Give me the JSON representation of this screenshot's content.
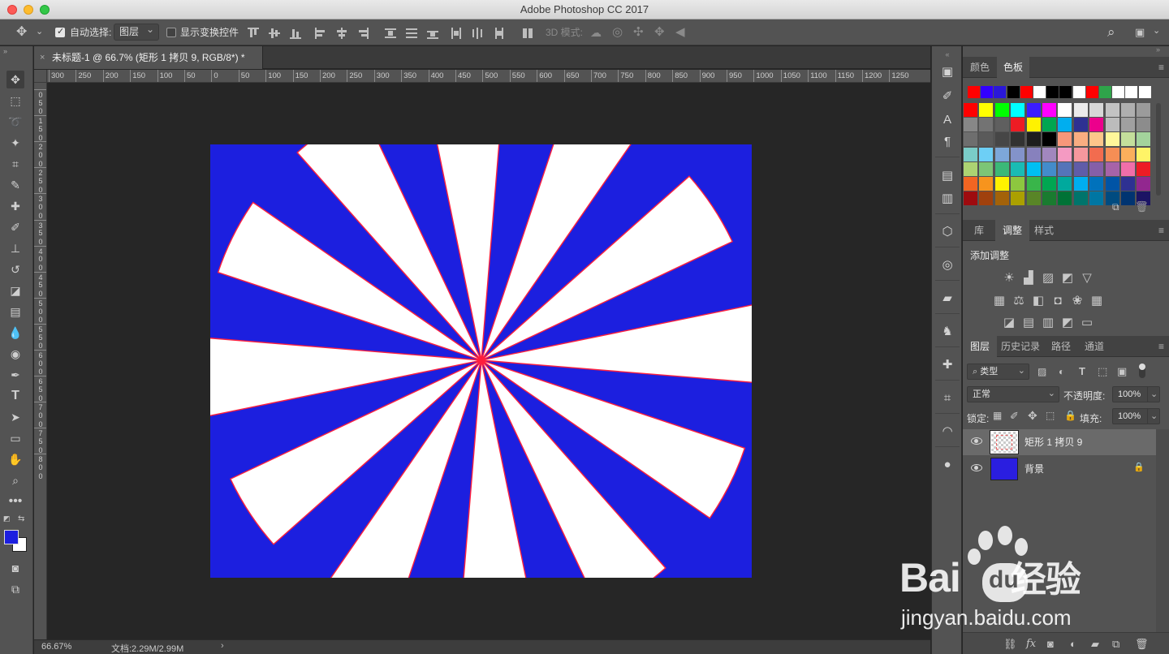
{
  "app": {
    "title": "Adobe Photoshop CC 2017"
  },
  "options_bar": {
    "auto_select_label": "自动选择:",
    "auto_select_target": "图层",
    "show_transform_label": "显示变换控件",
    "mode_3d_label": "3D 模式:"
  },
  "document": {
    "tab_title": "未标题-1 @ 66.7% (矩形 1 拷贝 9, RGB/8*) *",
    "close_glyph": "×"
  },
  "ruler": {
    "h_ticks": [
      "300",
      "250",
      "200",
      "150",
      "100",
      "50",
      "0",
      "50",
      "100",
      "150",
      "200",
      "250",
      "300",
      "350",
      "400",
      "450",
      "500",
      "550",
      "600",
      "650",
      "700",
      "750",
      "800",
      "850",
      "900",
      "950",
      "1000",
      "1050",
      "1100",
      "1150",
      "1200",
      "1250"
    ],
    "v_ticks": [
      "0",
      "5",
      "0",
      "1",
      "5",
      "0",
      "2",
      "0",
      "0",
      "2",
      "5",
      "0",
      "3",
      "0",
      "0",
      "3",
      "5",
      "0",
      "4",
      "0",
      "0",
      "4",
      "5",
      "0",
      "5",
      "0",
      "0",
      "5",
      "5",
      "0",
      "6",
      "0",
      "0",
      "6",
      "5",
      "0",
      "7",
      "0",
      "0",
      "7",
      "5",
      "0",
      "8",
      "0",
      "0"
    ]
  },
  "status": {
    "zoom": "66.67%",
    "doc": "文档:2.29M/2.99M"
  },
  "canvas": {
    "background_color": "#1c1fdf",
    "ray_fill": "#ffffff",
    "ray_stroke": "#ff1f3d",
    "rays_count": 12
  },
  "swatches_panel": {
    "tabs": [
      "颜色",
      "色板"
    ],
    "active_tab": "色板",
    "recent": [
      "#ff0000",
      "#3200ff",
      "#2a18d8",
      "#000000",
      "#ff0000",
      "#ffffff",
      "#000000",
      "#000000",
      "#ffffff",
      "#ff0000",
      "#2fa44a",
      "#ffffff",
      "#ffffff",
      "#ffffff"
    ],
    "grid": [
      [
        "#ff0000",
        "#ffff00",
        "#00ff00",
        "#00ffff",
        "#3b1cff",
        "#ff00ff",
        "#ffffff",
        "#ebebeb",
        "#d7d7d7",
        "#c3c3c3",
        "#afafaf",
        "#9b9b9b"
      ],
      [
        "#878787",
        "#737373",
        "#5f5f5f",
        "#ed1c24",
        "#fff200",
        "#00a651",
        "#00aeef",
        "#2e3192",
        "#ec008c",
        "#bcbcbc",
        "#a0a0a0",
        "#8c8c8c"
      ],
      [
        "#6e6e6e",
        "#5a5a5a",
        "#464646",
        "#323232",
        "#1e1e1e",
        "#000000",
        "#f7977a",
        "#f9ad81",
        "#fdc68a",
        "#fff79a",
        "#c4df9b",
        "#a3d39c"
      ],
      [
        "#7accc8",
        "#6dcff6",
        "#7da7d9",
        "#8393ca",
        "#8781bd",
        "#a187be",
        "#f49ac2",
        "#f6989d",
        "#f26c4f",
        "#f68e55",
        "#fbaf5c",
        "#fff467"
      ],
      [
        "#acd372",
        "#7cc576",
        "#3bb878",
        "#1abbb4",
        "#00bff3",
        "#438ccb",
        "#5574b9",
        "#605ca8",
        "#855fa8",
        "#a763a8",
        "#f06ea9",
        "#ed1c24"
      ],
      [
        "#f26522",
        "#f7941d",
        "#fff200",
        "#8dc73f",
        "#39b54a",
        "#00a651",
        "#00a99d",
        "#00aeef",
        "#0072bc",
        "#0054a6",
        "#2e3192",
        "#92278f"
      ],
      [
        "#9e0b0f",
        "#a0410d",
        "#a36209",
        "#aba000",
        "#598527",
        "#1a7b30",
        "#007236",
        "#00746b",
        "#0076a3",
        "#004b80",
        "#003471",
        "#1b1464"
      ]
    ]
  },
  "adjustments_panel": {
    "tabs": [
      "库",
      "调整",
      "样式"
    ],
    "active_tab": "调整",
    "heading": "添加调整",
    "icons_row1": [
      "brightness-icon",
      "levels-icon",
      "curves-icon",
      "exposure-icon",
      "vibrance-icon"
    ],
    "icons_row2": [
      "hue-saturation-icon",
      "color-balance-icon",
      "black-white-icon",
      "photo-filter-icon",
      "channel-mixer-icon",
      "color-lookup-icon"
    ],
    "icons_row3": [
      "invert-icon",
      "posterize-icon",
      "threshold-icon",
      "selective-color-icon",
      "gradient-map-icon"
    ]
  },
  "layers_panel": {
    "tabs": [
      "图层",
      "历史记录",
      "路径",
      "通道"
    ],
    "active_tab": "图层",
    "filter_label": "类型",
    "blend_mode": "正常",
    "opacity_label": "不透明度:",
    "opacity_value": "100%",
    "lock_label": "锁定:",
    "fill_label": "填充:",
    "fill_value": "100%",
    "layers": [
      {
        "name": "矩形 1 拷贝 9",
        "selected": true,
        "thumb": "transparent"
      },
      {
        "name": "背景",
        "selected": false,
        "thumb": "#2a1ee0",
        "locked": true
      }
    ]
  },
  "watermark": {
    "brand": "Bai",
    "brand2": "经验",
    "url": "jingyan.baidu.com"
  }
}
